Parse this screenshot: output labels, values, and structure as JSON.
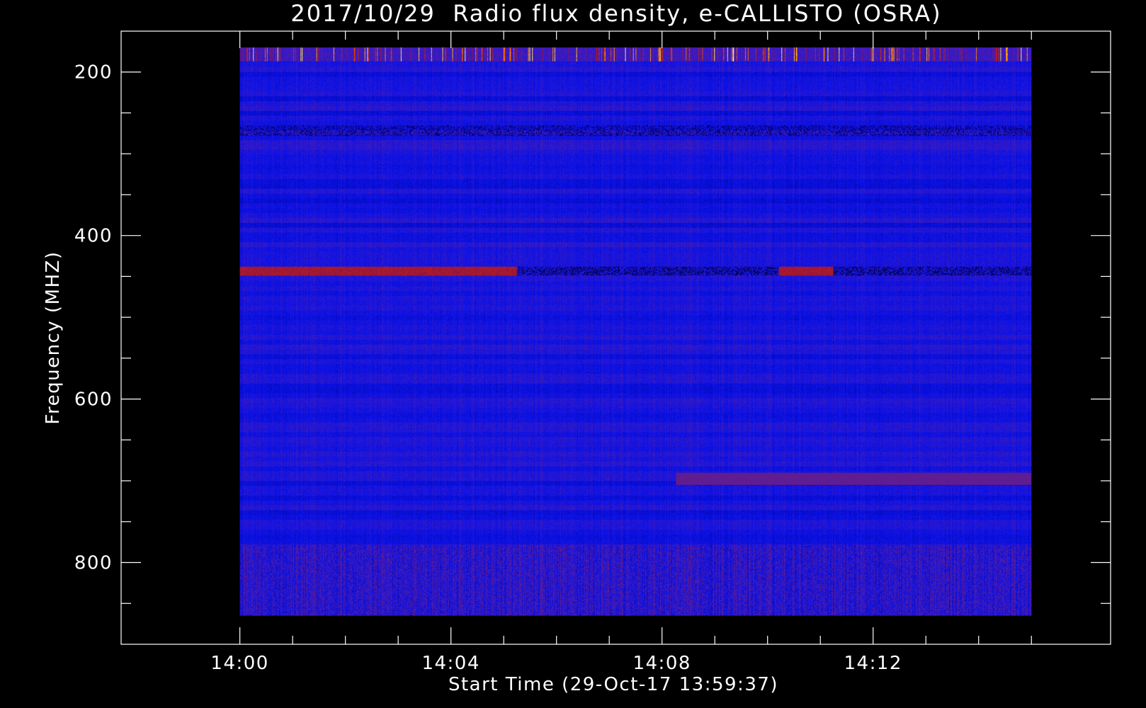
{
  "chart_data": {
    "type": "heatmap",
    "title": "2017/10/29  Radio flux density, e-CALLISTO (OSRA)",
    "xlabel": "Start Time (29-Oct-17 13:59:37)",
    "ylabel": "Frequency (MHZ)",
    "x_ticks": [
      "14:00",
      "14:04",
      "14:08",
      "14:12"
    ],
    "x_minor_ticks": [
      "14:01",
      "14:02",
      "14:03",
      "14:05",
      "14:06",
      "14:07",
      "14:09",
      "14:10",
      "14:11",
      "14:13",
      "14:14",
      "14:15"
    ],
    "y_ticks": [
      200,
      400,
      600,
      800
    ],
    "y_minor_ticks": [
      250,
      300,
      350,
      450,
      500,
      550,
      650,
      700,
      750,
      850
    ],
    "y_reversed": true,
    "xlim": [
      "13:57:45",
      "14:16:30"
    ],
    "ylim": [
      150,
      900
    ],
    "data_time_range": [
      "14:00:00",
      "14:15:00"
    ],
    "data_freq_range": [
      170,
      865
    ],
    "colormap": [
      "#000000",
      "#000080",
      "#0000ff",
      "#5a1a90",
      "#b01010",
      "#ff4000",
      "#ff9000",
      "#ffff60"
    ],
    "background_color": "#0a12e8",
    "features": [
      {
        "name": "band",
        "freq": [
          170,
          186
        ],
        "level": "bursty-hot"
      },
      {
        "name": "band",
        "freq": [
          438,
          448
        ],
        "level": "red-interference"
      },
      {
        "name": "band",
        "freq": [
          778,
          865
        ],
        "level": "mixed-red-blue"
      }
    ]
  }
}
